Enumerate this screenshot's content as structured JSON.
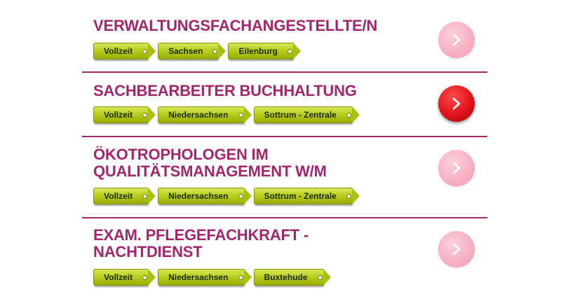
{
  "jobs": [
    {
      "title_lines": [
        "VERWALTUNGSFACHANGESTELLTE/N"
      ],
      "tags": [
        "Vollzeit",
        "Sachsen",
        "Eilenburg"
      ],
      "button_state": "inactive"
    },
    {
      "title_lines": [
        "SACHBEARBEITER BUCHHALTUNG"
      ],
      "tags": [
        "Vollzeit",
        "Niedersachsen",
        "Sottrum - Zentrale"
      ],
      "button_state": "active"
    },
    {
      "title_lines": [
        "ÖKOTROPHOLOGEN IM",
        "QUALITÄTSMANAGEMENT W/M"
      ],
      "tags": [
        "Vollzeit",
        "Niedersachsen",
        "Sottrum - Zentrale"
      ],
      "button_state": "inactive"
    },
    {
      "title_lines": [
        "EXAM. PFLEGEFACHKRAFT -",
        "NACHTDIENST"
      ],
      "tags": [
        "Vollzeit",
        "Niedersachsen",
        "Buxtehude"
      ],
      "button_state": "inactive"
    }
  ],
  "colors": {
    "title": "#a0286a",
    "divider": "#a0286a",
    "tag_green": "#b9cf1e",
    "button_active": "#e0141a",
    "button_inactive": "#f5aabd"
  },
  "icons": {
    "button": "chevron-right-icon"
  }
}
